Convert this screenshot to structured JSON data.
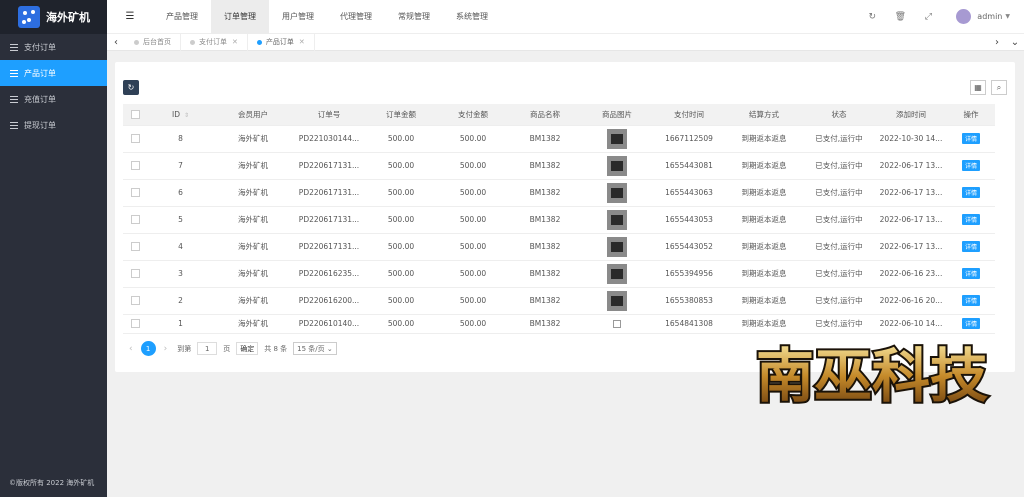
{
  "app": {
    "name": "海外矿机"
  },
  "sidebar": {
    "items": [
      {
        "label": "支付订单",
        "active": false
      },
      {
        "label": "产品订单",
        "active": true
      },
      {
        "label": "充值订单",
        "active": false
      },
      {
        "label": "提现订单",
        "active": false
      }
    ],
    "copyright": "©版权所有 2022 海外矿机"
  },
  "header": {
    "menu": [
      "产品管理",
      "订单管理",
      "用户管理",
      "代理管理",
      "常规管理",
      "系统管理"
    ],
    "active_menu": "订单管理",
    "user": "admin"
  },
  "tabs": {
    "items": [
      {
        "label": "后台首页",
        "closable": false,
        "active": false
      },
      {
        "label": "支付订单",
        "closable": true,
        "active": false
      },
      {
        "label": "产品订单",
        "closable": true,
        "active": true
      }
    ]
  },
  "table": {
    "headers": [
      "ID",
      "会员用户",
      "订单号",
      "订单金额",
      "支付金额",
      "商品名称",
      "商品图片",
      "支付时间",
      "结算方式",
      "状态",
      "添加时间",
      "操作"
    ],
    "detail_label": "详情",
    "rows": [
      {
        "id": "8",
        "user": "海外矿机",
        "order_no": "PD221030144...",
        "order_amount": "500.00",
        "pay_amount": "500.00",
        "product": "BM1382",
        "image": "thumb",
        "pay_time": "1667112509",
        "settle": "到期返本返息",
        "status": "已支付,运行中",
        "added": "2022-10-30 14..."
      },
      {
        "id": "7",
        "user": "海外矿机",
        "order_no": "PD220617131...",
        "order_amount": "500.00",
        "pay_amount": "500.00",
        "product": "BM1382",
        "image": "thumb",
        "pay_time": "1655443081",
        "settle": "到期返本返息",
        "status": "已支付,运行中",
        "added": "2022-06-17 13..."
      },
      {
        "id": "6",
        "user": "海外矿机",
        "order_no": "PD220617131...",
        "order_amount": "500.00",
        "pay_amount": "500.00",
        "product": "BM1382",
        "image": "thumb",
        "pay_time": "1655443063",
        "settle": "到期返本返息",
        "status": "已支付,运行中",
        "added": "2022-06-17 13..."
      },
      {
        "id": "5",
        "user": "海外矿机",
        "order_no": "PD220617131...",
        "order_amount": "500.00",
        "pay_amount": "500.00",
        "product": "BM1382",
        "image": "thumb",
        "pay_time": "1655443053",
        "settle": "到期返本返息",
        "status": "已支付,运行中",
        "added": "2022-06-17 13..."
      },
      {
        "id": "4",
        "user": "海外矿机",
        "order_no": "PD220617131...",
        "order_amount": "500.00",
        "pay_amount": "500.00",
        "product": "BM1382",
        "image": "thumb",
        "pay_time": "1655443052",
        "settle": "到期返本返息",
        "status": "已支付,运行中",
        "added": "2022-06-17 13..."
      },
      {
        "id": "3",
        "user": "海外矿机",
        "order_no": "PD220616235...",
        "order_amount": "500.00",
        "pay_amount": "500.00",
        "product": "BM1382",
        "image": "thumb",
        "pay_time": "1655394956",
        "settle": "到期返本返息",
        "status": "已支付,运行中",
        "added": "2022-06-16 23..."
      },
      {
        "id": "2",
        "user": "海外矿机",
        "order_no": "PD220616200...",
        "order_amount": "500.00",
        "pay_amount": "500.00",
        "product": "BM1382",
        "image": "thumb",
        "pay_time": "1655380853",
        "settle": "到期返本返息",
        "status": "已支付,运行中",
        "added": "2022-06-16 20..."
      },
      {
        "id": "1",
        "user": "海外矿机",
        "order_no": "PD220610140...",
        "order_amount": "500.00",
        "pay_amount": "500.00",
        "product": "BM1382",
        "image": "broken",
        "pay_time": "1654841308",
        "settle": "到期返本返息",
        "status": "已支付,运行中",
        "added": "2022-06-10 14..."
      }
    ]
  },
  "pager": {
    "current_page": "1",
    "goto_label": "到第",
    "page_input": "1",
    "page_unit": "页",
    "confirm_label": "确定",
    "total_label": "共 8 条",
    "per_page": "15 条/页"
  },
  "watermark": {
    "text": "南巫科技"
  }
}
